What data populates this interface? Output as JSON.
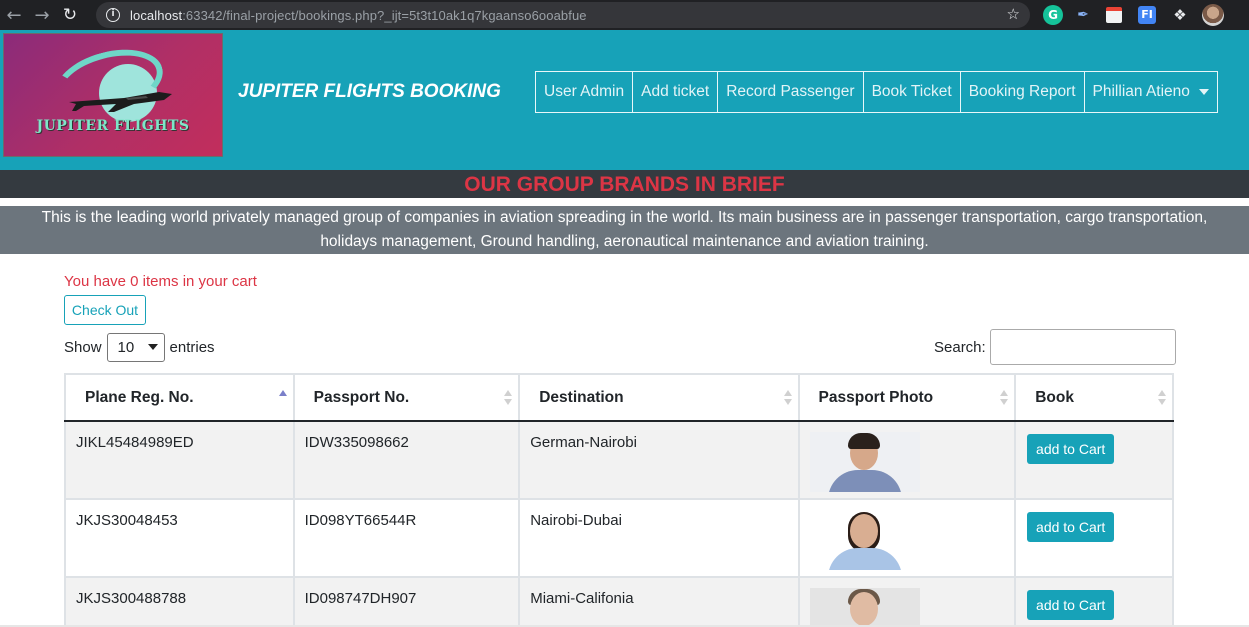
{
  "browser": {
    "url_host": "localhost",
    "url_rest": ":63342/final-project/bookings.php?_ijt=5t3t10ak1q7kgaanso6ooabfue",
    "ext_g": "G",
    "ext_fi": "FI"
  },
  "header": {
    "logo_text": "JUPITER FLIGHTS",
    "brand": "JUPITER FLIGHTS BOOKING",
    "menu": [
      {
        "label": "User Admin"
      },
      {
        "label": "Add ticket"
      },
      {
        "label": "Record Passenger"
      },
      {
        "label": "Book Ticket"
      },
      {
        "label": "Booking Report"
      },
      {
        "label": "Phillian Atieno"
      }
    ]
  },
  "banner": {
    "title": "OUR GROUP BRANDS IN BRIEF",
    "about_line1": "This is the leading world privately managed group of companies in aviation spreading in the world. Its main business are in passenger transportation, cargo transportation,",
    "about_line2": "holidays management, Ground handling, aeronautical maintenance and aviation training."
  },
  "cart": {
    "message": "You have 0 items in your cart",
    "checkout_label": "Check Out"
  },
  "table_controls": {
    "show_label": "Show",
    "entries_value": "10",
    "entries_label": "entries",
    "search_label": "Search:"
  },
  "table": {
    "columns": [
      "Plane Reg. No.",
      "Passport No.",
      "Destination",
      "Passport Photo",
      "Book"
    ],
    "rows": [
      {
        "plane": "JIKL45484989ED",
        "passport": "IDW335098662",
        "destination": "German-Nairobi",
        "action": "add to Cart"
      },
      {
        "plane": "JKJS30048453",
        "passport": "ID098YT66544R",
        "destination": "Nairobi-Dubai",
        "action": "add to Cart"
      },
      {
        "plane": "JKJS300488788",
        "passport": "ID098747DH907",
        "destination": "Miami-Califonia",
        "action": "add to Cart"
      }
    ]
  },
  "colors": {
    "header_bg": "#17a2b8",
    "banner_bg": "#343a40",
    "banner_title": "#dc3545",
    "about_bg": "#6c757d",
    "button": "#17a2b8"
  }
}
